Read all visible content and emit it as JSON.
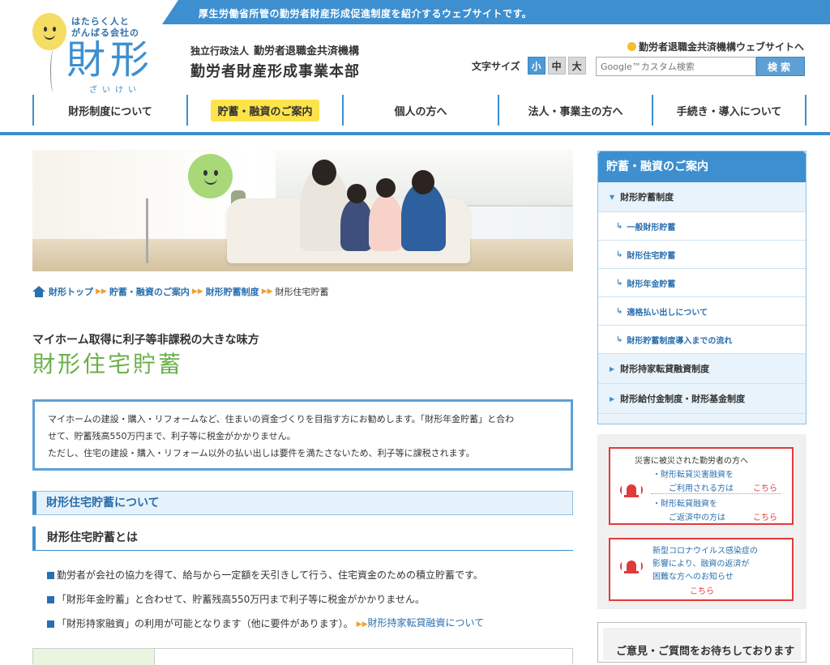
{
  "top_banner": {
    "tagline": "厚生労働省所管の勤労者財産形成促進制度を紹介するウェブサイトです。"
  },
  "logo": {
    "small_line1": "はたらく人と",
    "small_line2": "がんばる会社の",
    "big": "財形",
    "ruby": "ざいけい"
  },
  "org": {
    "prefix": "独立行政法人",
    "name": "勤労者退職金共済機構",
    "division": "勤労者財産形成事業本部"
  },
  "header": {
    "external_link": "勤労者退職金共済機構ウェブサイトへ",
    "font_size_label": "文字サイズ",
    "font_sizes": [
      "小",
      "中",
      "大"
    ],
    "search_placeholder": "Google™カスタム検索",
    "search_button": "検索"
  },
  "nav": {
    "items": [
      "財形制度について",
      "貯蓄・融資のご案内",
      "個人の方へ",
      "法人・事業主の方へ",
      "手続き・導入について"
    ],
    "active": "貯蓄・融資のご案内"
  },
  "breadcrumb": {
    "items": [
      "財形トップ",
      "貯蓄・融資のご案内",
      "財形貯蓄制度"
    ],
    "current": "財形住宅貯蓄"
  },
  "main": {
    "subheading": "マイホーム取得に利子等非課税の大きな味方",
    "title": "財形住宅貯蓄",
    "intro": [
      "マイホームの建設・購入・リフォームなど、住まいの資金づくりを目指す方にお勧めします。「財形年金貯蓄」と合わ",
      "せて、貯蓄残高550万円まで、利子等に税金がかかりません。",
      "ただし、住宅の建設・購入・リフォーム以外の払い出しは要件を満たさないため、利子等に課税されます。"
    ],
    "section_title": "財形住宅貯蓄について",
    "subsection_title": "財形住宅貯蓄とは",
    "bullets": [
      "勤労者が会社の協力を得て、給与から一定額を天引きして行う、住宅資金のための積立貯蓄です。",
      "「財形年金貯蓄」と合わせて、貯蓄残高550万円まで利子等に税金がかかりません。",
      "「財形持家融資」の利用が可能となります（他に要件があります）。"
    ],
    "bullet_link": "財形持家転貸融資について"
  },
  "sidebar": {
    "title": "貯蓄・融資のご案内",
    "category_open": "財形貯蓄制度",
    "sub_items": [
      "一般財形貯蓄",
      "財形住宅貯蓄",
      "財形年金貯蓄",
      "適格払い出しについて",
      "財形貯蓄制度導入までの流れ"
    ],
    "categories": [
      "財形持家転貸融資制度",
      "財形給付金制度・財形基金制度"
    ]
  },
  "alerts": {
    "disaster": {
      "title": "災害に被災された勤労者の方へ",
      "item1_line1": "・財形転貸災害融資を",
      "item1_line2": "ご利用される方は",
      "item2_line1": "・財形転貸融資を",
      "item2_line2": "ご返済中の方は",
      "link": "こちら"
    },
    "corona": {
      "line1": "新型コロナウイルス感染症の",
      "line2": "影響により、融資の返済が",
      "line3": "困難な方へのお知らせ",
      "link": "こちら"
    }
  },
  "opinion": {
    "title": "ご意見・ご質問をお待ちしております"
  },
  "colors": {
    "brand_blue": "#3d8fd0",
    "accent_yellow": "#fde34a",
    "title_green": "#6bb04a",
    "alert_red": "#e03b3b"
  }
}
